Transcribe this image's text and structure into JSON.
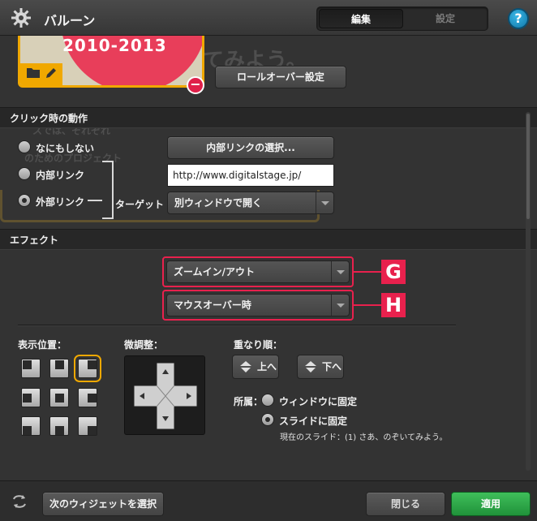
{
  "window": {
    "title": "バルーン",
    "tabs": [
      {
        "label": "編集",
        "active": true
      },
      {
        "label": "設定",
        "active": false
      }
    ],
    "help_label": "?"
  },
  "preview": {
    "thumb_text": "2010-2013",
    "ghost_line1": "てみよう。",
    "ghost_line2": "スでは、それぞれ",
    "ghost_line3": "のためのプロジェクト",
    "remove_label": "−",
    "rollover_button": "ロールオーバー設定"
  },
  "click_action": {
    "header": "クリック時の動作",
    "options": [
      {
        "label": "なにもしない",
        "selected": false
      },
      {
        "label": "内部リンク",
        "selected": false
      },
      {
        "label": "外部リンク",
        "selected": true
      }
    ],
    "internal_link_button": "内部リンクの選択...",
    "url_value": "http://www.digitalstage.jp/",
    "target_label": "ターゲット",
    "target_select": "別ウィンドウで開く"
  },
  "effect": {
    "header": "エフェクト",
    "effect_select": "ズームイン/アウト",
    "trigger_select": "マウスオーバー時",
    "marker_g": "G",
    "marker_h": "H",
    "highlight_color": "#e8214d"
  },
  "layout": {
    "position_label": "表示位置：",
    "position_grid_selected": "top-right",
    "fine_tune_label": "微調整：",
    "order_label": "重なり順：",
    "order_up": "上へ",
    "order_down": "下へ",
    "belong_label": "所属：",
    "belong_options": [
      {
        "label": "ウィンドウに固定",
        "selected": false
      },
      {
        "label": "スライドに固定",
        "selected": true
      }
    ],
    "current_slide_note": "現在のスライド：(1) さあ、のぞいてみよう。"
  },
  "footer": {
    "next_widget_button": "次のウィジェットを選択",
    "close_button": "閉じる",
    "apply_button": "適用",
    "apply_color": "#2aa447"
  }
}
